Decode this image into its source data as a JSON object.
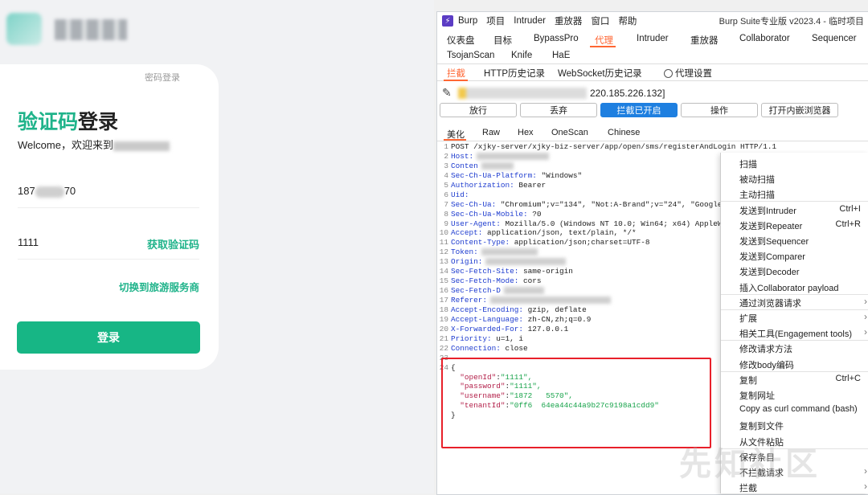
{
  "login": {
    "password_login": "密码登录",
    "title_green": "验证码",
    "title_black": "登录",
    "welcome": "Welcome，欢迎来到",
    "phone_prefix": "187",
    "phone_suffix": "70",
    "code_value": "1111",
    "get_code": "获取验证码",
    "switch_tour": "切换到旅游服务商",
    "login_button": "登录"
  },
  "burp": {
    "menu": [
      "Burp",
      "项目",
      "Intruder",
      "重放器",
      "窗口",
      "帮助"
    ],
    "title": "Burp Suite专业版  v2023.4 - 临时项目",
    "tabs_row1": [
      "仪表盘",
      "目标",
      "BypassPro",
      "代理",
      "Intruder",
      "重放器",
      "Collaborator",
      "Sequencer"
    ],
    "tabs_row1b": [
      "TsojanScan",
      "Knife",
      "HaE"
    ],
    "active_tab": "代理",
    "tabs_row2": [
      "拦截",
      "HTTP历史记录",
      "WebSocket历史记录",
      "代理设置"
    ],
    "target_ip": "220.185.226.132]",
    "buttons": [
      "放行",
      "丢弃",
      "拦截已开启",
      "操作",
      "打开内嵌浏览器"
    ],
    "view_tabs": [
      "美化",
      "Raw",
      "Hex",
      "OneScan",
      "Chinese"
    ],
    "request_lines": [
      {
        "n": "1",
        "k": "",
        "v": "POST /xjky-server/xjky-biz-server/app/open/sms/registerAndLogin HTTP/1.1"
      },
      {
        "n": "2",
        "k": "Host:",
        "v": ""
      },
      {
        "n": "3",
        "k": "Conten",
        "v": ""
      },
      {
        "n": "4",
        "k": "Sec-Ch-Ua-Platform:",
        "v": " \"Windows\""
      },
      {
        "n": "5",
        "k": "Authorization:",
        "v": " Bearer"
      },
      {
        "n": "6",
        "k": "Uid:",
        "v": ""
      },
      {
        "n": "7",
        "k": "Sec-Ch-Ua:",
        "v": " \"Chromium\";v=\"134\", \"Not:A-Brand\";v=\"24\", \"Google"
      },
      {
        "n": "8",
        "k": "Sec-Ch-Ua-Mobile:",
        "v": " ?0"
      },
      {
        "n": "9",
        "k": "User-Agent:",
        "v": " Mozilla/5.0 (Windows NT 10.0; Win64; x64) AppleW"
      },
      {
        "n": "10",
        "k": "Accept:",
        "v": " application/json, text/plain, */*"
      },
      {
        "n": "11",
        "k": "Content-Type:",
        "v": " application/json;charset=UTF-8"
      },
      {
        "n": "12",
        "k": "Token:",
        "v": ""
      },
      {
        "n": "13",
        "k": "Origin:",
        "v": ""
      },
      {
        "n": "14",
        "k": "Sec-Fetch-Site:",
        "v": " same-origin"
      },
      {
        "n": "15",
        "k": "Sec-Fetch-Mode:",
        "v": " cors"
      },
      {
        "n": "16",
        "k": "Sec-Fetch-D",
        "v": ""
      },
      {
        "n": "17",
        "k": "Referer:",
        "v": ""
      },
      {
        "n": "18",
        "k": "Accept-Encoding:",
        "v": " gzip, deflate"
      },
      {
        "n": "19",
        "k": "Accept-Language:",
        "v": " zh-CN,zh;q=0.9"
      },
      {
        "n": "20",
        "k": "X-Forwarded-For:",
        "v": " 127.0.0.1"
      },
      {
        "n": "21",
        "k": "Priority:",
        "v": " u=1, i"
      },
      {
        "n": "22",
        "k": "Connection:",
        "v": " close"
      },
      {
        "n": "23",
        "k": "",
        "v": ""
      },
      {
        "n": "24",
        "k": "",
        "v": "{"
      },
      {
        "n": "",
        "k": "",
        "v": "",
        "jk": "\"openId\"",
        "jv": "\"1111\","
      },
      {
        "n": "",
        "k": "",
        "v": "",
        "jk": "\"password\"",
        "jv": "\"1111\","
      },
      {
        "n": "",
        "k": "",
        "v": "",
        "jk": "\"username\"",
        "jv": "\"1872   5570\","
      },
      {
        "n": "",
        "k": "",
        "v": "",
        "jk": "\"tenantId\"",
        "jv": "\"0ff6  64ea44c44a9b27c9198a1cdd9\""
      },
      {
        "n": "",
        "k": "",
        "v": "}"
      }
    ],
    "context_menu": [
      {
        "label": "扫描",
        "shortcut": "",
        "arrow": false
      },
      {
        "label": "被动扫描",
        "shortcut": "",
        "arrow": false
      },
      {
        "label": "主动扫描",
        "shortcut": "",
        "arrow": false
      },
      {
        "label": "发送到Intruder",
        "shortcut": "Ctrl+I",
        "arrow": false
      },
      {
        "label": "发送到Repeater",
        "shortcut": "Ctrl+R",
        "arrow": false
      },
      {
        "label": "发送到Sequencer",
        "shortcut": "",
        "arrow": false
      },
      {
        "label": "发送到Comparer",
        "shortcut": "",
        "arrow": false
      },
      {
        "label": "发送到Decoder",
        "shortcut": "",
        "arrow": false
      },
      {
        "label": "插入Collaborator payload",
        "shortcut": "",
        "arrow": false
      },
      {
        "label": "通过浏览器请求",
        "shortcut": "",
        "arrow": true
      },
      {
        "label": "扩展",
        "shortcut": "",
        "arrow": true
      },
      {
        "label": "相关工具(Engagement tools)",
        "shortcut": "",
        "arrow": true
      },
      {
        "label": "修改请求方法",
        "shortcut": "",
        "arrow": false
      },
      {
        "label": "修改body编码",
        "shortcut": "",
        "arrow": false
      },
      {
        "label": "复制",
        "shortcut": "Ctrl+C",
        "arrow": false
      },
      {
        "label": "复制网址",
        "shortcut": "",
        "arrow": false
      },
      {
        "label": "Copy as curl command (bash)",
        "shortcut": "",
        "arrow": false
      },
      {
        "label": "复制到文件",
        "shortcut": "",
        "arrow": false
      },
      {
        "label": "从文件粘贴",
        "shortcut": "",
        "arrow": false
      },
      {
        "label": "保存条目",
        "shortcut": "",
        "arrow": false
      },
      {
        "label": "不拦截请求",
        "shortcut": "",
        "arrow": true
      },
      {
        "label": "拦截",
        "shortcut": "",
        "arrow": true
      }
    ]
  },
  "colors": {
    "accent_green": "#17b685",
    "burp_orange": "#ff6633",
    "intercept_blue": "#1e7fe0",
    "highlight_red": "#e8202a"
  }
}
